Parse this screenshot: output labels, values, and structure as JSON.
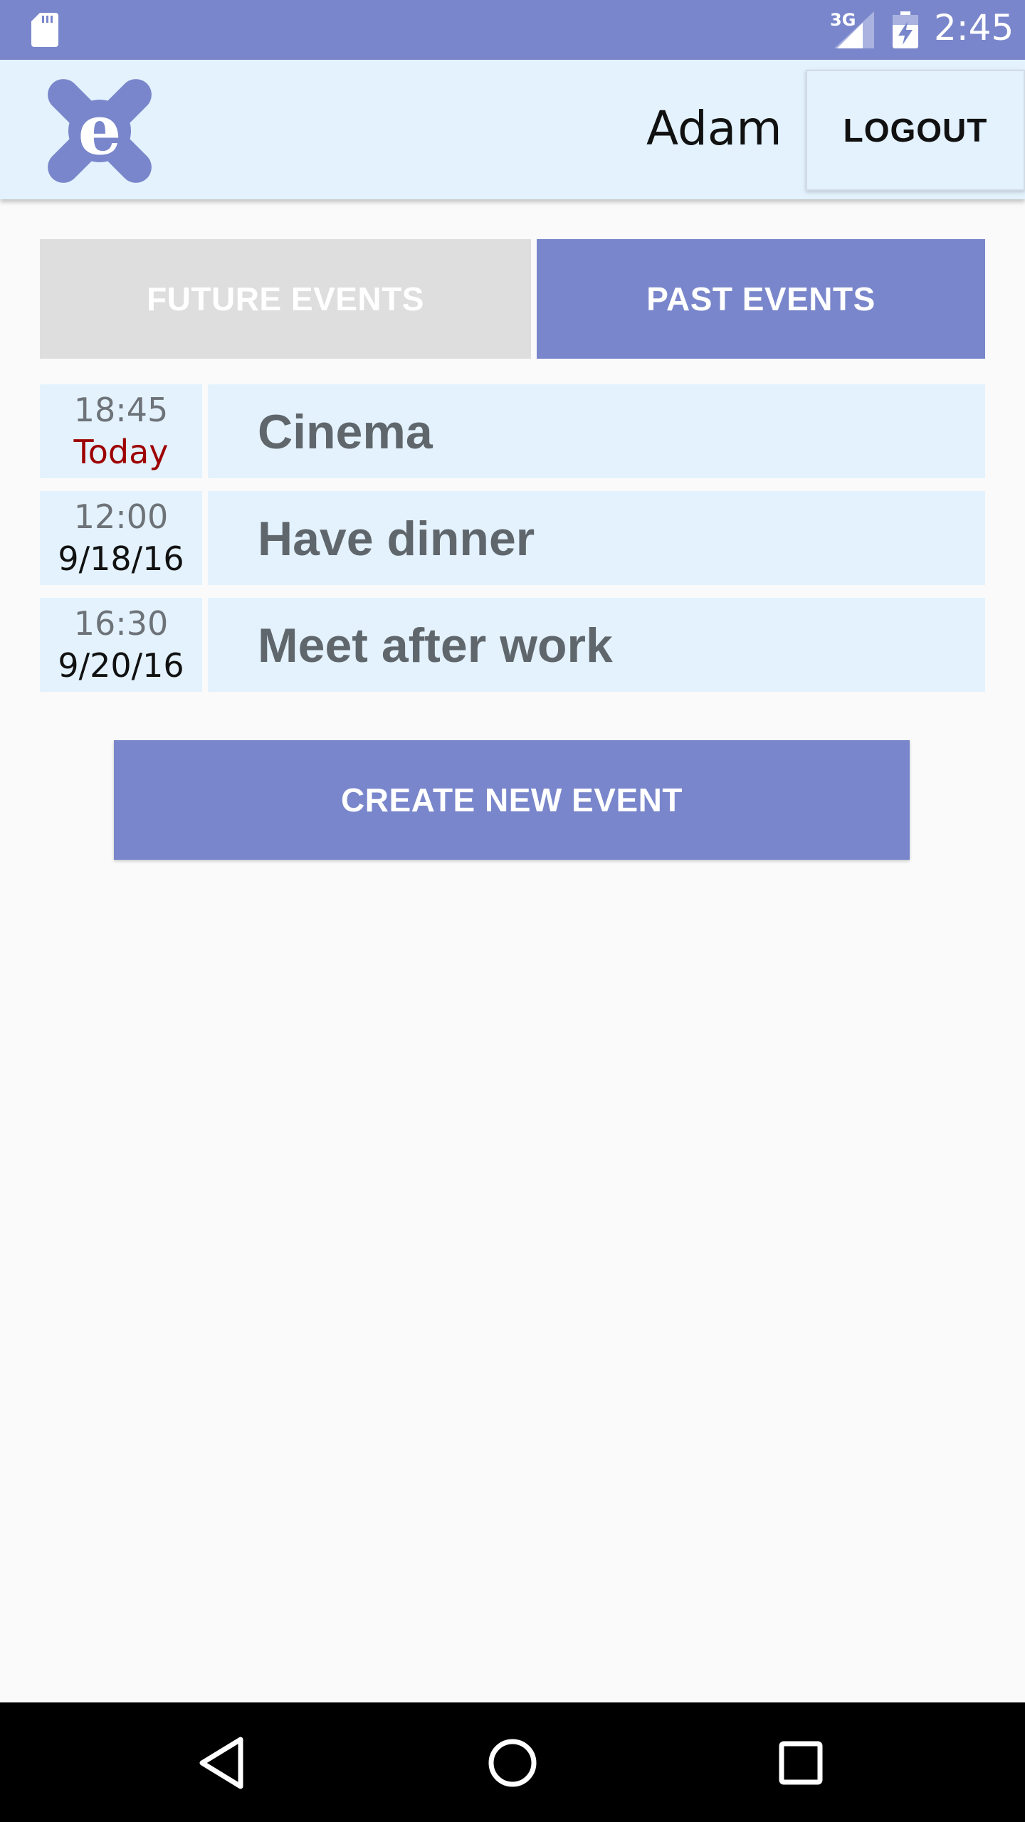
{
  "status_bar": {
    "network": "3G",
    "time": "2:45",
    "icons": [
      "sd-card-icon",
      "signal-icon",
      "battery-charging-icon"
    ]
  },
  "header": {
    "logo_icon": "app-logo-e-icon",
    "user_name": "Adam",
    "logout_label": "LOGOUT"
  },
  "tabs": [
    {
      "label": "FUTURE EVENTS",
      "selected": false
    },
    {
      "label": "PAST EVENTS",
      "selected": true
    }
  ],
  "events": [
    {
      "time": "18:45",
      "date": "Today",
      "title": "Cinema"
    },
    {
      "time": "12:00",
      "date": "9/18/16",
      "title": "Have dinner"
    },
    {
      "time": "16:30",
      "date": "9/20/16",
      "title": "Meet after work"
    }
  ],
  "create_button_label": "CREATE NEW EVENT",
  "nav_bar": {
    "icons": [
      "back-icon",
      "home-icon",
      "recents-icon"
    ]
  },
  "colors": {
    "accent": "#7986cb",
    "row_background": "#e3f2fd",
    "today_text": "#9e0000",
    "inactive_tab": "#dedede"
  }
}
